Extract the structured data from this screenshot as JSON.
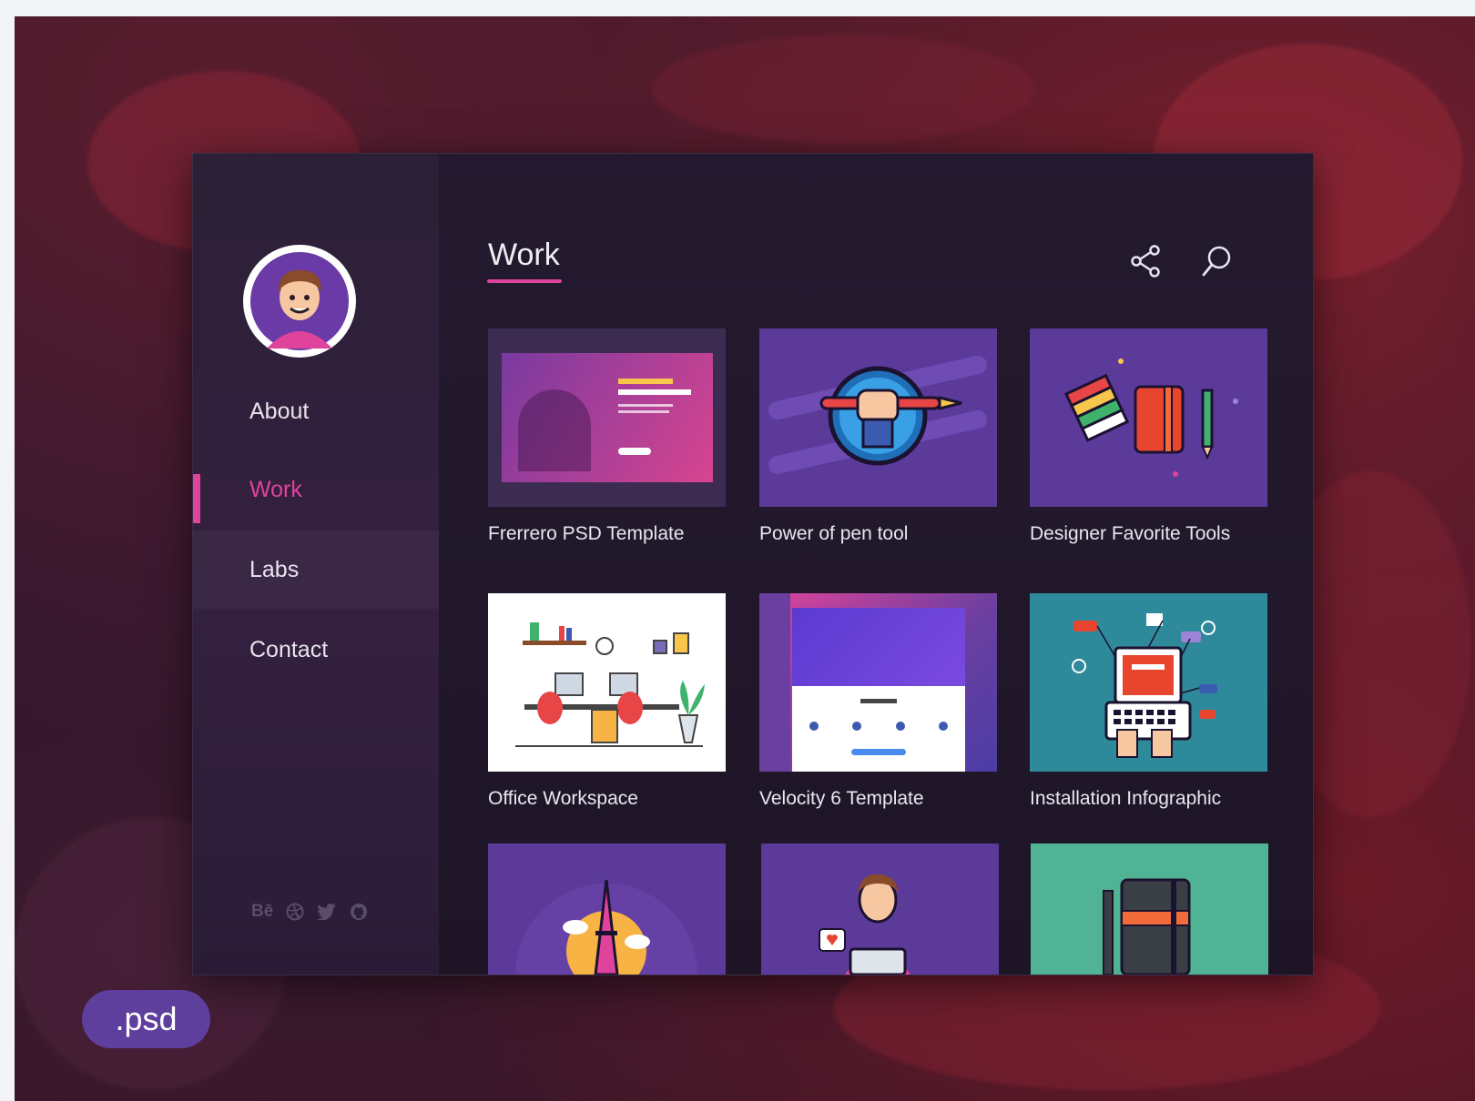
{
  "page": {
    "section_title": "Work",
    "badge": ".psd"
  },
  "sidebar": {
    "items": [
      {
        "label": "About",
        "state": "normal"
      },
      {
        "label": "Work",
        "state": "active"
      },
      {
        "label": "Labs",
        "state": "hover"
      },
      {
        "label": "Contact",
        "state": "normal"
      }
    ],
    "socials": [
      {
        "icon": "behance-icon",
        "text": "Bē"
      },
      {
        "icon": "dribbble-icon"
      },
      {
        "icon": "twitter-icon"
      },
      {
        "icon": "github-icon"
      }
    ]
  },
  "header_actions": [
    {
      "icon": "share-icon"
    },
    {
      "icon": "search-icon"
    }
  ],
  "projects": [
    {
      "title": "Frerrero PSD Template",
      "thumb_color": "#3d2c52"
    },
    {
      "title": "Power of pen tool",
      "thumb_color": "#5b3a9a"
    },
    {
      "title": "Designer Favorite Tools",
      "thumb_color": "#5b3a9a"
    },
    {
      "title": "Office Workspace",
      "thumb_color": "#ffffff"
    },
    {
      "title": "Velocity 6 Template",
      "thumb_color": "#6a3fa0"
    },
    {
      "title": "Installation Infographic",
      "thumb_color": "#2e8a9a"
    },
    {
      "title": "",
      "thumb_color": "#5b3a9a"
    },
    {
      "title": "",
      "thumb_color": "#5b3a9a"
    },
    {
      "title": "",
      "thumb_color": "#4fb394"
    }
  ],
  "colors": {
    "accent": "#e0439b",
    "window_bg": "#1d1526",
    "badge_bg": "#5f3f9e"
  }
}
